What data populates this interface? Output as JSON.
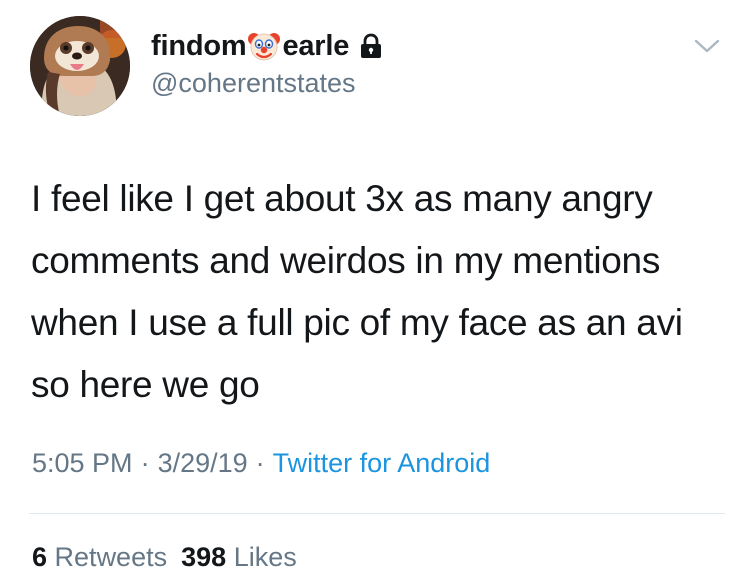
{
  "author": {
    "display_name_prefix": "findom",
    "display_name_suffix": "earle",
    "name_emoji": "clown-face-icon",
    "protected_icon": "lock-icon",
    "handle": "@coherentstates"
  },
  "tweet": {
    "text": "I feel like I get about 3x as many angry comments and weirdos in my mentions when I use a full pic of my face as an avi so here we go",
    "time": "5:05 PM",
    "date": "3/29/19",
    "source": "Twitter for Android",
    "separator": "·"
  },
  "stats": {
    "retweets_count": "6",
    "retweets_label": "Retweets",
    "likes_count": "398",
    "likes_label": "Likes"
  },
  "colors": {
    "text": "#14171a",
    "secondary": "#657786",
    "link": "#1b95e0",
    "divider": "#e1e8ed"
  }
}
